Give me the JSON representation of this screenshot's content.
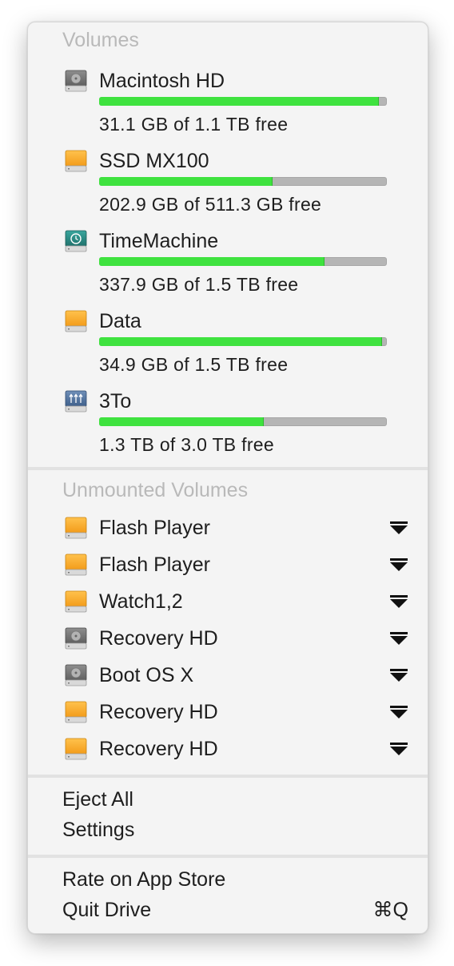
{
  "volumes_section": {
    "header": "Volumes",
    "items": [
      {
        "name": "Macintosh HD",
        "icon": "internal-disk-gray-icon",
        "free_text": "31.1 GB of 1.1 TB free",
        "used_fraction": 0.97
      },
      {
        "name": "SSD MX100",
        "icon": "external-disk-orange-icon",
        "free_text": "202.9 GB of 511.3 GB free",
        "used_fraction": 0.6
      },
      {
        "name": "TimeMachine",
        "icon": "time-machine-disk-icon",
        "free_text": "337.9 GB of 1.5 TB free",
        "used_fraction": 0.78
      },
      {
        "name": "Data",
        "icon": "external-disk-orange-icon",
        "free_text": "34.9 GB of 1.5 TB free",
        "used_fraction": 0.98
      },
      {
        "name": "3To",
        "icon": "network-disk-icon",
        "free_text": "1.3 TB of 3.0 TB free",
        "used_fraction": 0.57
      }
    ]
  },
  "unmounted_section": {
    "header": "Unmounted Volumes",
    "items": [
      {
        "name": "Flash Player",
        "icon": "external-disk-orange-icon"
      },
      {
        "name": "Flash Player",
        "icon": "external-disk-orange-icon"
      },
      {
        "name": "Watch1,2",
        "icon": "external-disk-orange-icon"
      },
      {
        "name": "Recovery HD",
        "icon": "internal-disk-gray-icon"
      },
      {
        "name": "Boot OS X",
        "icon": "internal-disk-gray-icon"
      },
      {
        "name": "Recovery HD",
        "icon": "external-disk-orange-icon"
      },
      {
        "name": "Recovery HD",
        "icon": "external-disk-orange-icon"
      }
    ]
  },
  "actions": {
    "eject_all": "Eject All",
    "settings": "Settings",
    "rate": "Rate on App Store",
    "quit": "Quit Drive",
    "quit_shortcut": "⌘Q"
  },
  "colors": {
    "bar_fill": "#3fe23f",
    "bar_track": "#b5b5b5",
    "header_text": "#b9b9b9"
  }
}
